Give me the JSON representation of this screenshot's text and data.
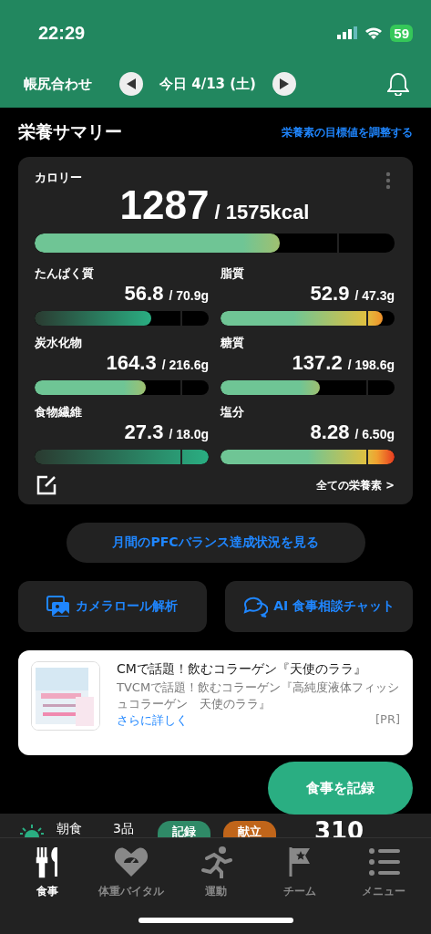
{
  "status_bar": {
    "time": "22:29",
    "battery": "59"
  },
  "header": {
    "left_label": "帳尻合わせ",
    "date": "今日 4/13 (土)"
  },
  "summary": {
    "title": "栄養サマリー",
    "adjust_link": "栄養素の目標値を調整する",
    "calorie": {
      "label": "カロリー",
      "value": "1287",
      "target": "/ 1575kcal",
      "level": 0.68
    },
    "nutrients": [
      {
        "label": "たんぱく質",
        "value": "56.8",
        "target": "/ 70.9g",
        "level": 0.67,
        "kind": "minimum"
      },
      {
        "label": "脂質",
        "value": "52.9",
        "target": "/ 47.3g",
        "level": 0.93,
        "kind": "maximum"
      },
      {
        "label": "炭水化物",
        "value": "164.3",
        "target": "/ 216.6g",
        "level": 0.64,
        "kind": "maximum"
      },
      {
        "label": "糖質",
        "value": "137.2",
        "target": "/ 198.6g",
        "level": 0.57,
        "kind": "maximum"
      },
      {
        "label": "食物繊維",
        "value": "27.3",
        "target": "/ 18.0g",
        "level": 1,
        "kind": "minimum"
      },
      {
        "label": "塩分",
        "value": "8.28",
        "target": "/ 6.50g",
        "level": 1,
        "kind": "maximum"
      }
    ],
    "all_link": "全ての栄養素 >"
  },
  "pfc_button": "月間のPFCバランス達成状況を見る",
  "actions": [
    "カメラロール解析",
    "AI 食事相談チャット"
  ],
  "ad": {
    "title": "CMで話題！飲むコラーゲン『天使のララ』",
    "body": "TVCMで話題！飲むコラーゲン『高純度液体フィッシュコラーゲン　天使のララ』",
    "more": "さらに詳しく",
    "pr": "[PR]"
  },
  "fab": "食事を記録",
  "meal_row": {
    "name": "朝食",
    "count": "3品",
    "record": "記録",
    "menu": "献立",
    "kcal": "310"
  },
  "tabs": [
    {
      "label": "食事",
      "selected": true
    },
    {
      "label": "体重バイタル",
      "selected": false
    },
    {
      "label": "運動",
      "selected": false
    },
    {
      "label": "チーム",
      "selected": false
    },
    {
      "label": "メニュー",
      "selected": false
    }
  ]
}
